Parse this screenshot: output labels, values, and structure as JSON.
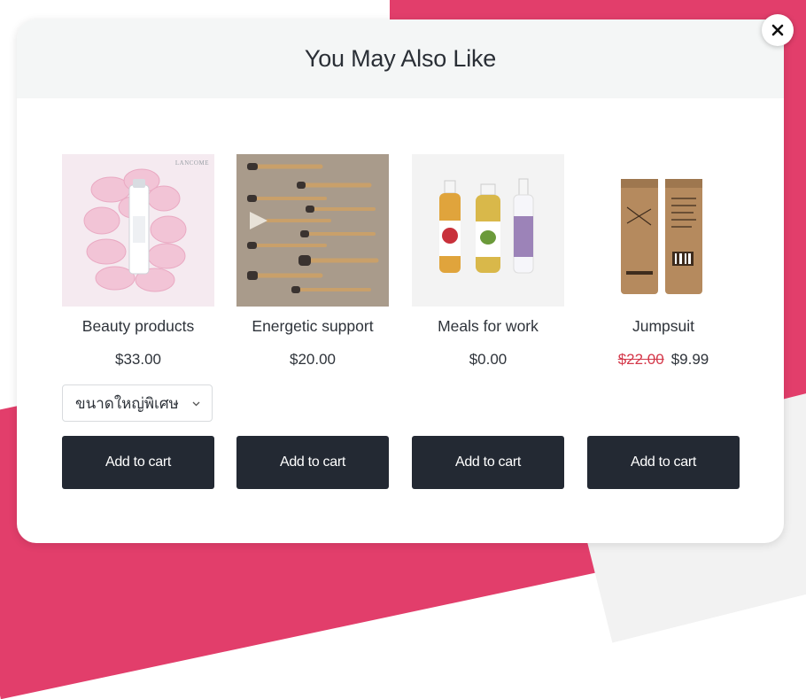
{
  "modal": {
    "title": "You May Also Like",
    "close_icon": "close-icon"
  },
  "products": [
    {
      "name": "Beauty products",
      "price": "$33.00",
      "variant": "ขนาดใหญ่พิเศษ",
      "button": "Add to cart",
      "image_brand_text": "LANCOME"
    },
    {
      "name": "Energetic support",
      "price": "$20.00",
      "button": "Add to cart"
    },
    {
      "name": "Meals for work",
      "price": "$0.00",
      "button": "Add to cart"
    },
    {
      "name": "Jumpsuit",
      "old_price": "$22.00",
      "price": "$9.99",
      "button": "Add to cart"
    }
  ],
  "colors": {
    "accent_pink": "#e23e6b",
    "button_dark": "#232933",
    "sale_red": "#d4384a"
  }
}
